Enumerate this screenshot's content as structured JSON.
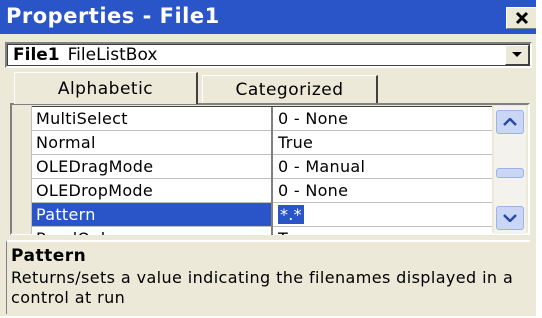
{
  "window": {
    "title": "Properties - File1"
  },
  "object_selector": {
    "object_name": "File1",
    "object_type": "FileListBox"
  },
  "tabs": [
    {
      "label": "Alphabetic",
      "active": true
    },
    {
      "label": "Categorized",
      "active": false
    }
  ],
  "properties": [
    {
      "name": "MultiSelect",
      "value": "0 - None"
    },
    {
      "name": "Normal",
      "value": "True"
    },
    {
      "name": "OLEDragMode",
      "value": "0 - Manual"
    },
    {
      "name": "OLEDropMode",
      "value": "0 - None"
    },
    {
      "name": "Pattern",
      "value": "*.*",
      "selected": true
    },
    {
      "name": "ReadOnly",
      "value": "True"
    }
  ],
  "description": {
    "title": "Pattern",
    "text": "Returns/sets a value indicating the filenames displayed in a control at run"
  },
  "colors": {
    "title_bar": "#2a55c9",
    "selection": "#2a55c9",
    "dialog_face": "#ece9d8"
  },
  "icons": {
    "close": "close-icon",
    "dropdown": "chevron-down-icon",
    "scroll_up": "scroll-up-icon",
    "scroll_down": "scroll-down-icon"
  }
}
